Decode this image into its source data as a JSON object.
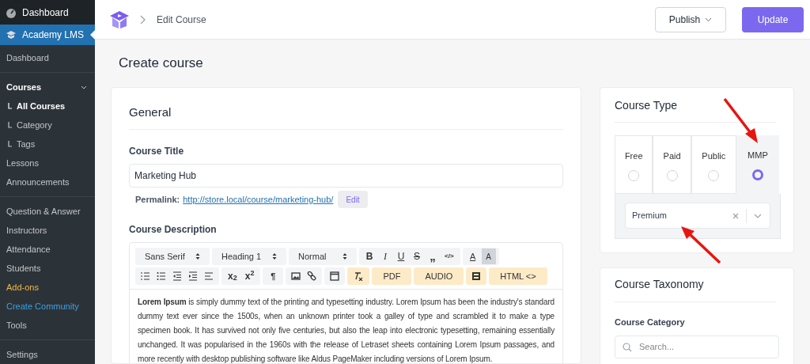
{
  "sidebar": {
    "top_items": [
      {
        "label": "Dashboard",
        "kind": "dashboard",
        "selected": false
      },
      {
        "label": "Academy LMS",
        "kind": "academy",
        "selected": true
      }
    ],
    "groups": [
      [
        {
          "label": "Dashboard",
          "kind": "item",
          "selected": false
        }
      ],
      [
        {
          "label": "Courses",
          "kind": "heading",
          "expanded": true
        },
        {
          "label": "All Courses",
          "kind": "sub",
          "selected": true
        },
        {
          "label": "Category",
          "kind": "sub",
          "selected": false
        },
        {
          "label": "Tags",
          "kind": "sub",
          "selected": false
        },
        {
          "label": "Lessons",
          "kind": "item",
          "selected": false
        },
        {
          "label": "Announcements",
          "kind": "item",
          "selected": false
        }
      ],
      [
        {
          "label": "Question & Answer",
          "kind": "item",
          "selected": false
        },
        {
          "label": "Instructors",
          "kind": "item",
          "selected": false
        },
        {
          "label": "Attendance",
          "kind": "item",
          "selected": false
        },
        {
          "label": "Students",
          "kind": "item",
          "selected": false
        },
        {
          "label": "Add-ons",
          "kind": "item",
          "selected": false,
          "color": "#f0b849"
        },
        {
          "label": "Create Community",
          "kind": "item",
          "selected": false,
          "color": "#3ba0e6"
        },
        {
          "label": "Tools",
          "kind": "item",
          "selected": false
        }
      ],
      [
        {
          "label": "Settings",
          "kind": "item",
          "selected": false
        }
      ]
    ]
  },
  "header": {
    "breadcrumb": "Edit Course",
    "publish_button": "Publish",
    "update_button": "Update"
  },
  "page_title": "Create course",
  "general": {
    "title": "General",
    "course_title_label": "Course Title",
    "course_title_value": "Marketing Hub",
    "permalink_label": "Permalink:",
    "permalink_url": "http://store.local/course/marketing-hub/",
    "permalink_edit": "Edit",
    "description_label": "Course Description",
    "toolbar": [
      [
        {
          "highlighted": false,
          "items": [
            {
              "kind": "select",
              "label": "Sans Serif"
            }
          ]
        },
        {
          "highlighted": false,
          "items": [
            {
              "kind": "select",
              "label": "Heading 1"
            }
          ]
        },
        {
          "highlighted": false,
          "items": [
            {
              "kind": "select",
              "label": "Normal"
            }
          ]
        },
        {
          "highlighted": false,
          "items": [
            {
              "kind": "bold",
              "label": "B"
            },
            {
              "kind": "italic",
              "label": "I"
            },
            {
              "kind": "underline",
              "label": "U"
            },
            {
              "kind": "strike",
              "label": "S"
            },
            {
              "kind": "quote",
              "label": "„"
            },
            {
              "kind": "code",
              "label": "</>"
            }
          ]
        },
        {
          "highlighted": false,
          "items": [
            {
              "kind": "text-color",
              "label": "A"
            },
            {
              "kind": "background-color",
              "label": "A"
            }
          ]
        }
      ],
      [
        {
          "highlighted": false,
          "items": [
            {
              "kind": "ordered-list"
            },
            {
              "kind": "bullet-list"
            },
            {
              "kind": "outdent"
            },
            {
              "kind": "indent"
            },
            {
              "kind": "align"
            }
          ]
        },
        {
          "highlighted": false,
          "items": [
            {
              "kind": "script",
              "label": "x$_{2}$"
            },
            {
              "kind": "script",
              "label": "x$^{2}$"
            }
          ]
        },
        {
          "highlighted": false,
          "items": [
            {
              "kind": "direction",
              "label": "¶"
            }
          ]
        },
        {
          "highlighted": false,
          "items": [
            {
              "kind": "image"
            },
            {
              "kind": "link"
            }
          ]
        },
        {
          "highlighted": false,
          "items": [
            {
              "kind": "table"
            }
          ]
        },
        {
          "highlighted": true,
          "items": [
            {
              "kind": "clear-format"
            }
          ]
        },
        {
          "highlighted": true,
          "items": [
            {
              "kind": "text",
              "label": "PDF"
            }
          ]
        },
        {
          "highlighted": true,
          "items": [
            {
              "kind": "text",
              "label": "AUDIO"
            }
          ]
        },
        {
          "highlighted": true,
          "items": [
            {
              "kind": "film"
            }
          ]
        },
        {
          "highlighted": true,
          "items": [
            {
              "kind": "text",
              "label": "HTML <>"
            }
          ]
        }
      ]
    ],
    "description_text": "**Lorem Ipsum** is simply dummy text of the printing and typesetting industry. Lorem Ipsum has been the industry's standard dummy text ever since the 1500s, when an unknown printer took a galley of type and scrambled it to make a type specimen book. It has survived not only five centuries, but also the leap into electronic typesetting, remaining essentially unchanged. It was popularised in the 1960s with the release of Letraset sheets containing Lorem Ipsum passages, and more recently with desktop publishing software like Aldus PageMaker including versions of Lorem Ipsum."
  },
  "course_type": {
    "title": "Course Type",
    "options": [
      {
        "label": "Free",
        "selected": false
      },
      {
        "label": "Paid",
        "selected": false
      },
      {
        "label": "Public",
        "selected": false
      },
      {
        "label": "MMP",
        "selected": true
      }
    ],
    "plan_value": "Premium"
  },
  "course_taxonomy": {
    "title": "Course Taxonomy",
    "category_label": "Course Category",
    "search_placeholder": "Search..."
  }
}
